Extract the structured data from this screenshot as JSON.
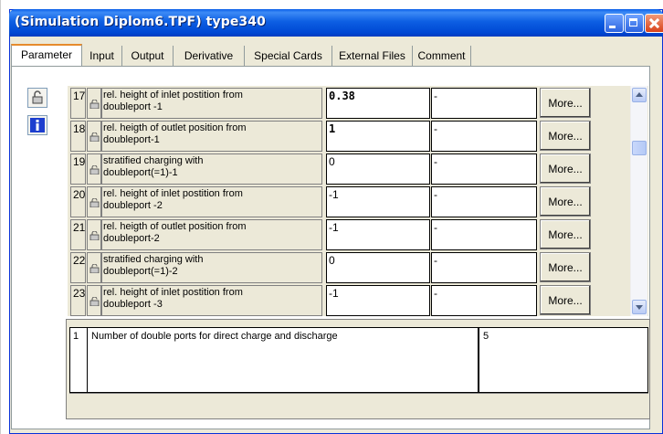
{
  "window": {
    "title": "(Simulation Diplom6.TPF) type340",
    "minimize": "minimize-button",
    "maximize": "maximize-button",
    "close": "close-button"
  },
  "tabs": [
    {
      "label": "Parameter",
      "active": true
    },
    {
      "label": "Input",
      "active": false
    },
    {
      "label": "Output",
      "active": false
    },
    {
      "label": "Derivative",
      "active": false
    },
    {
      "label": "Special Cards",
      "active": false
    },
    {
      "label": "External Files",
      "active": false
    },
    {
      "label": "Comment",
      "active": false
    }
  ],
  "rows": [
    {
      "num": "17",
      "name_1": "rel. height of inlet postition from",
      "name_2": "doubleport -1",
      "value": "0.38",
      "unit": "-",
      "more": "More..."
    },
    {
      "num": "18",
      "name_1": "rel. heigth of outlet position from",
      "name_2": "doubleport-1",
      "value": "1",
      "unit": "-",
      "more": "More..."
    },
    {
      "num": "19",
      "name_1": "stratified charging with",
      "name_2": "doubleport(=1)-1",
      "value": "0",
      "unit": "-",
      "more": "More..."
    },
    {
      "num": "20",
      "name_1": "rel. height of inlet postition from",
      "name_2": "doubleport -2",
      "value": "-1",
      "unit": "-",
      "more": "More..."
    },
    {
      "num": "21",
      "name_1": "rel. heigth of outlet position from",
      "name_2": "doubleport-2",
      "value": "-1",
      "unit": "-",
      "more": "More..."
    },
    {
      "num": "22",
      "name_1": "stratified charging with",
      "name_2": "doubleport(=1)-2",
      "value": "0",
      "unit": "-",
      "more": "More..."
    },
    {
      "num": "23",
      "name_1": "rel. height of inlet postition from",
      "name_2": "doubleport -3",
      "value": "-1",
      "unit": "-",
      "more": "More..."
    }
  ],
  "detail": {
    "num": "1",
    "text": "Number of double ports for direct charge and discharge",
    "value": "5"
  },
  "colors": {
    "titlebar": "#0048d4",
    "window_bg": "#ece9d8",
    "active_tab_accent": "#e68b2c"
  }
}
